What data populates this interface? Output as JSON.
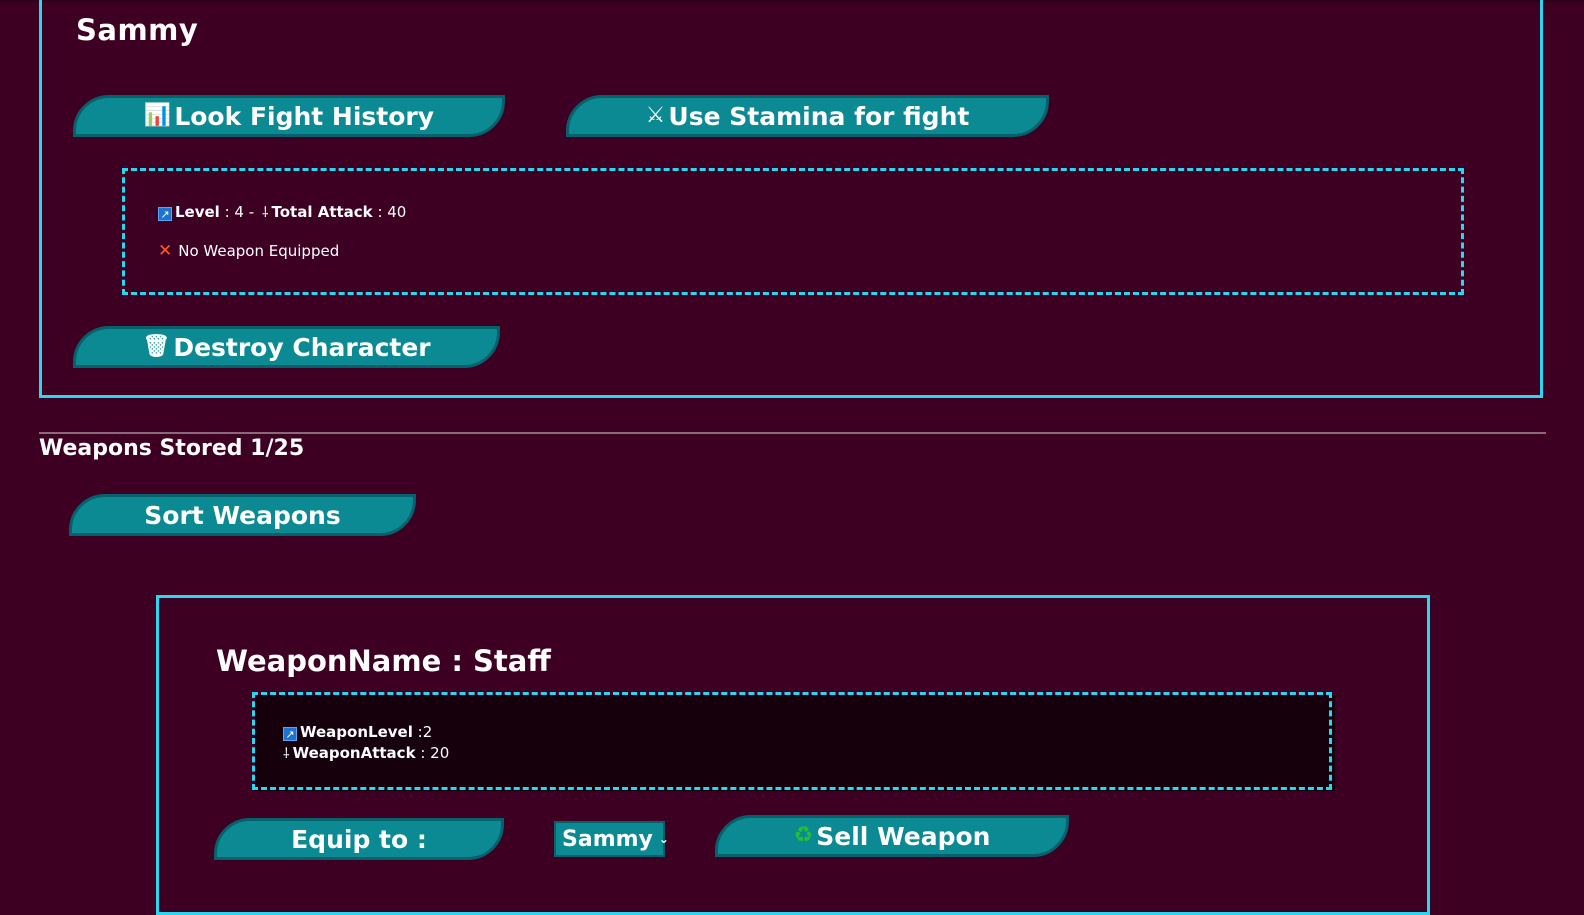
{
  "character": {
    "name": "Sammy",
    "fight_history_label": "Look Fight History",
    "fight_history_icon": "chart-icon",
    "stamina_label": "Use Stamina for fight",
    "stamina_icon": "crossed-swords-icon",
    "level_label": "Level",
    "level_value": ": 4 -",
    "total_attack_label": "Total Attack",
    "total_attack_value": ": 40",
    "no_weapon_text": "No Weapon Equipped",
    "destroy_label": "Destroy Character",
    "destroy_icon": "trash-icon"
  },
  "weapons": {
    "stored_title": "Weapons Stored 1/25",
    "sort_label": "Sort Weapons",
    "items": [
      {
        "name_line": "WeaponName : Staff",
        "level_label": "WeaponLevel",
        "level_value": ":2",
        "attack_label": "WeaponAttack",
        "attack_value": ": 20",
        "equip_label": "Equip to :",
        "equip_selected": "Sammy",
        "sell_label": "Sell Weapon",
        "sell_icon": "recycle-icon"
      }
    ]
  },
  "colors": {
    "background": "#3e0022",
    "accent_border": "#29d7ef",
    "button": "#0b8a93"
  }
}
